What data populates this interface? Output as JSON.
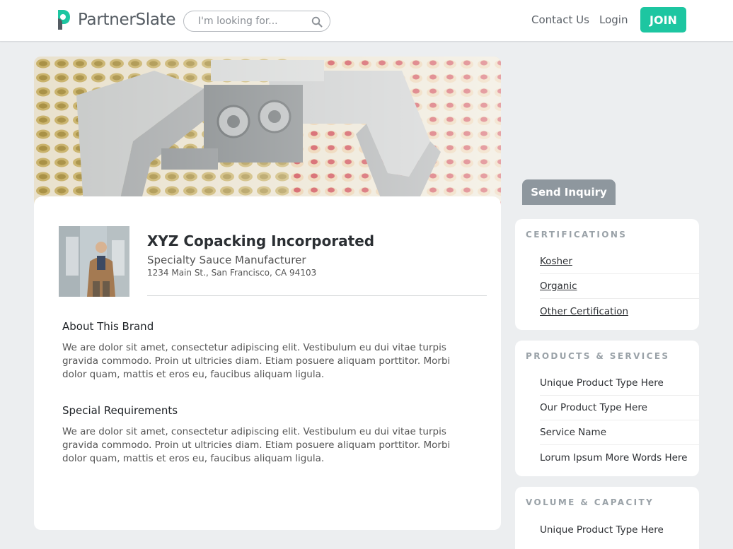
{
  "header": {
    "logo_text": "PartnerSlate",
    "search_placeholder": "I'm looking for...",
    "contact_label": "Contact Us",
    "login_label": "Login",
    "join_label": "JOIN"
  },
  "colors": {
    "accent": "#1dc6a1",
    "inquiry_button": "#8e979e",
    "background": "#eceef0"
  },
  "company": {
    "name": "XYZ Copacking Incorporated",
    "type": "Specialty Sauce Manufacturer",
    "address": "1234 Main St., San Francisco, CA 94103"
  },
  "about": {
    "title": "About This Brand",
    "body": "We are dolor sit amet, consectetur adipiscing elit. Vestibulum eu dui vitae turpis gravida commodo. Proin ut ultricies diam. Etiam posuere aliquam porttitor. Morbi dolor quam, mattis et eros eu, faucibus aliquam ligula."
  },
  "requirements": {
    "title": "Special Requirements",
    "body": "We are dolor sit amet, consectetur adipiscing elit. Vestibulum eu dui vitae turpis gravida commodo. Proin ut ultricies diam. Etiam posuere aliquam porttitor. Morbi dolor quam, mattis et eros eu, faucibus aliquam ligula."
  },
  "inquiry_label": "Send Inquiry",
  "certifications": {
    "title": "CERTIFICATIONS",
    "items": [
      "Kosher",
      "Organic",
      "Other Certification"
    ]
  },
  "products": {
    "title": "PRODUCTS & SERVICES",
    "items": [
      "Unique Product Type Here",
      "Our Product Type Here",
      "Service Name",
      "Lorum Ipsum More Words Here"
    ]
  },
  "volume": {
    "title": "VOLUME & CAPACITY",
    "items": [
      "Unique Product Type Here"
    ]
  }
}
